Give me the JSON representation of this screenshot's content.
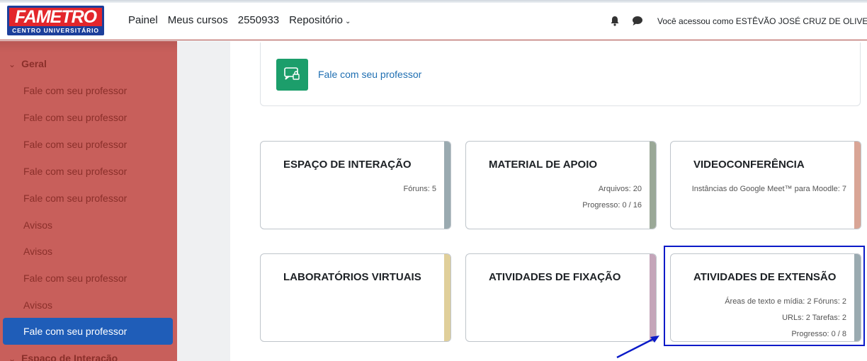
{
  "header": {
    "logo_text": "FAMETRO",
    "logo_subtext": "CENTRO UNIVERSITÁRIO",
    "nav": [
      "Painel",
      "Meus cursos",
      "2550933",
      "Repositório"
    ],
    "user_text": "Você acessou como ESTÊVÃO JOSÉ CRUZ DE OLIVEIRA"
  },
  "sidebar": {
    "section_geral": "Geral",
    "items": [
      "Fale com seu professor",
      "Fale com seu professor",
      "Fale com seu professor",
      "Fale com seu professor",
      "Fale com seu professor",
      "Avisos",
      "Avisos",
      "Fale com seu professor",
      "Avisos"
    ],
    "active_item": "Fale com seu professor",
    "section_next": "Espaço de Interação"
  },
  "main": {
    "talk_link": "Fale com seu professor",
    "cards": [
      {
        "title": "ESPAÇO DE INTERAÇÃO",
        "lines": [
          "Fóruns: 5"
        ],
        "color": "#9aaab0"
      },
      {
        "title": "MATERIAL DE APOIO",
        "lines": [
          "Arquivos: 20",
          "Progresso: 0 / 16"
        ],
        "color": "#9aa897"
      },
      {
        "title": "VIDEOCONFERÊNCIA",
        "lines": [
          "Instâncias do Google Meet™ para Moodle: 7"
        ],
        "color": "#d9a596"
      },
      {
        "title": "LABORATÓRIOS VIRTUAIS",
        "lines": [],
        "color": "#e0cf9a"
      },
      {
        "title": "ATIVIDADES DE FIXAÇÃO",
        "lines": [],
        "color": "#c4a5b9"
      },
      {
        "title": "ATIVIDADES DE EXTENSÃO",
        "lines": [
          "Áreas de texto e mídia: 2   Fóruns: 2",
          "URLs: 2   Tarefas: 2",
          "Progresso: 0 / 8"
        ],
        "color": "#9aaab0"
      }
    ]
  }
}
